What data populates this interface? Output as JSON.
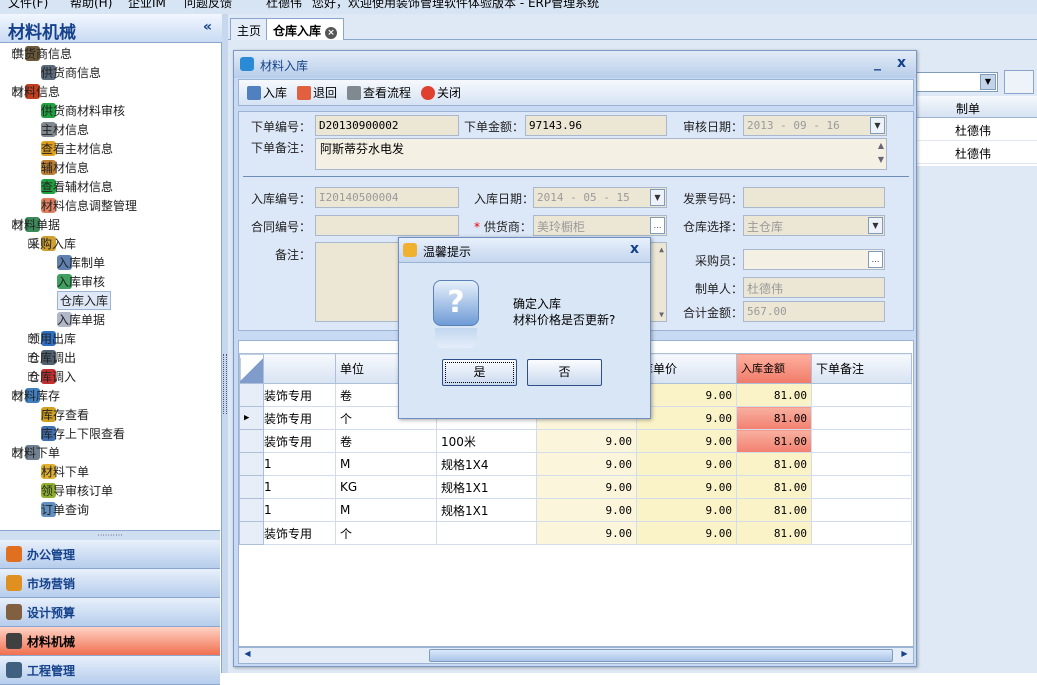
{
  "topbar": {
    "menu_file": "文件(F)",
    "menu_help": "帮助(H)",
    "menu_im": "企业IM",
    "menu_feedback": "问题反馈",
    "user": "杜德伟",
    "welcome": "您好，欢迎使用装饰管理软件体验版本 - ERP管理系统"
  },
  "sidebar": {
    "title": "材料机械",
    "collapse": "«",
    "tree": [
      {
        "label": "供货商信息",
        "level": 0,
        "pm": "−",
        "color": "#6a5a3a"
      },
      {
        "label": "供货商信息",
        "level": 1,
        "color": "#5a6a7a"
      },
      {
        "label": "材料信息",
        "level": 0,
        "pm": "−",
        "color": "#c04020"
      },
      {
        "label": "供货商材料审核",
        "level": 1,
        "color": "#20a040"
      },
      {
        "label": "主材信息",
        "level": 1,
        "color": "#808890"
      },
      {
        "label": "查看主材信息",
        "level": 1,
        "color": "#e0a020"
      },
      {
        "label": "辅材信息",
        "level": 1,
        "color": "#c08030"
      },
      {
        "label": "查看辅材信息",
        "level": 1,
        "color": "#20a040"
      },
      {
        "label": "材料信息调整管理",
        "level": 1,
        "color": "#e08060"
      },
      {
        "label": "材料单据",
        "level": 0,
        "pm": "−",
        "color": "#3a8a5a"
      },
      {
        "label": "采购入库",
        "level": 1,
        "pm": "−",
        "color": "#d0a030"
      },
      {
        "label": "入库制单",
        "level": 2,
        "color": "#6080b0"
      },
      {
        "label": "入库审核",
        "level": 2,
        "color": "#40a060"
      },
      {
        "label": "仓库入库",
        "level": 2,
        "color": "#c09050",
        "selected": true
      },
      {
        "label": "入库单据",
        "level": 2,
        "color": "#b0b8c8"
      },
      {
        "label": "领用出库",
        "level": 1,
        "pm": "+",
        "color": "#3070c0"
      },
      {
        "label": "仓库调出",
        "level": 1,
        "pm": "+",
        "color": "#506070"
      },
      {
        "label": "仓库调入",
        "level": 1,
        "pm": "+",
        "color": "#c03030"
      },
      {
        "label": "材料库存",
        "level": 0,
        "pm": "−",
        "color": "#4080c0"
      },
      {
        "label": "库存查看",
        "level": 1,
        "color": "#d0a020"
      },
      {
        "label": "库存上下限查看",
        "level": 1,
        "color": "#4070b0"
      },
      {
        "label": "材料下单",
        "level": 0,
        "pm": "−",
        "color": "#708090"
      },
      {
        "label": "材料下单",
        "level": 1,
        "color": "#e0b030"
      },
      {
        "label": "领导审核订单",
        "level": 1,
        "color": "#90b030"
      },
      {
        "label": "订单查询",
        "level": 1,
        "color": "#6090c0"
      }
    ],
    "nav": [
      {
        "label": "办公管理",
        "color": "#e07020"
      },
      {
        "label": "市场营销",
        "color": "#e09020"
      },
      {
        "label": "设计预算",
        "color": "#806040"
      },
      {
        "label": "材料机械",
        "color": "#404040",
        "active": true
      },
      {
        "label": "工程管理",
        "color": "#406080"
      }
    ]
  },
  "tabs": {
    "home": "主页",
    "current": "仓库入库",
    "close": "×"
  },
  "background_grid": {
    "header": "制单",
    "rows": [
      "杜德伟",
      "杜德伟"
    ]
  },
  "window": {
    "title": "材料入库",
    "minimize": "_",
    "close": "x",
    "toolbar": [
      "入库",
      "退回",
      "查看流程",
      "关闭"
    ],
    "toolbar_colors": [
      "#5080c0",
      "#e06040",
      "#808890",
      "#e04030"
    ]
  },
  "form": {
    "order_no_label": "下单编号：",
    "order_no": "D20130900002",
    "order_amount_label": "下单金额：",
    "order_amount": "97143.96",
    "review_date_label": "审核日期：",
    "review_date": "2013 - 09 - 16",
    "order_remark_label": "下单备注：",
    "order_remark": "阿斯蒂芬水电发",
    "in_no_label": "入库编号：",
    "in_no": "I20140500004",
    "in_date_label": "入库日期：",
    "in_date": "2014 - 05 - 15",
    "invoice_label": "发票号码：",
    "invoice": "",
    "contract_label": "合同编号：",
    "contract": "",
    "supplier_req": "*",
    "supplier_label": "供货商：",
    "supplier": "美玲橱柜",
    "warehouse_label": "仓库选择：",
    "warehouse": "主仓库",
    "remark_label": "备注：",
    "buyer_label": "采购员：",
    "buyer": "",
    "creator_label": "制单人：",
    "creator": "杜德伟",
    "total_label": "合计金额：",
    "total": "567.00"
  },
  "grid": {
    "headers": [
      "单位",
      "",
      "",
      "库单价",
      "入库金额",
      "下单备注"
    ],
    "rows": [
      {
        "name": "装饰专用",
        "unit": "卷",
        "spec": "",
        "price": "",
        "in_price": "9.00",
        "amount": "81.00",
        "red": false,
        "cur": false
      },
      {
        "name": "装饰专用",
        "unit": "个",
        "spec": "",
        "price": "",
        "in_price": "9.00",
        "amount": "81.00",
        "red": true,
        "cur": true
      },
      {
        "name": "装饰专用",
        "unit": "卷",
        "spec": "100米",
        "price": "9.00",
        "in_price": "9.00",
        "amount": "81.00",
        "red": true,
        "cur": false
      },
      {
        "name": "1",
        "unit": "M",
        "spec": "规格1X4",
        "price": "9.00",
        "in_price": "9.00",
        "amount": "81.00",
        "red": false,
        "cur": false
      },
      {
        "name": "1",
        "unit": "KG",
        "spec": "规格1X1",
        "price": "9.00",
        "in_price": "9.00",
        "amount": "81.00",
        "red": false,
        "cur": false
      },
      {
        "name": "1",
        "unit": "M",
        "spec": "规格1X1",
        "price": "9.00",
        "in_price": "9.00",
        "amount": "81.00",
        "red": false,
        "cur": false
      },
      {
        "name": "装饰专用",
        "unit": "个",
        "spec": "",
        "price": "9.00",
        "in_price": "9.00",
        "amount": "81.00",
        "red": false,
        "cur": false
      }
    ]
  },
  "dialog": {
    "title": "温馨提示",
    "close": "x",
    "icon": "?",
    "line1": "确定入库",
    "line2": "材料价格是否更新?",
    "yes": "是",
    "no": "否"
  }
}
